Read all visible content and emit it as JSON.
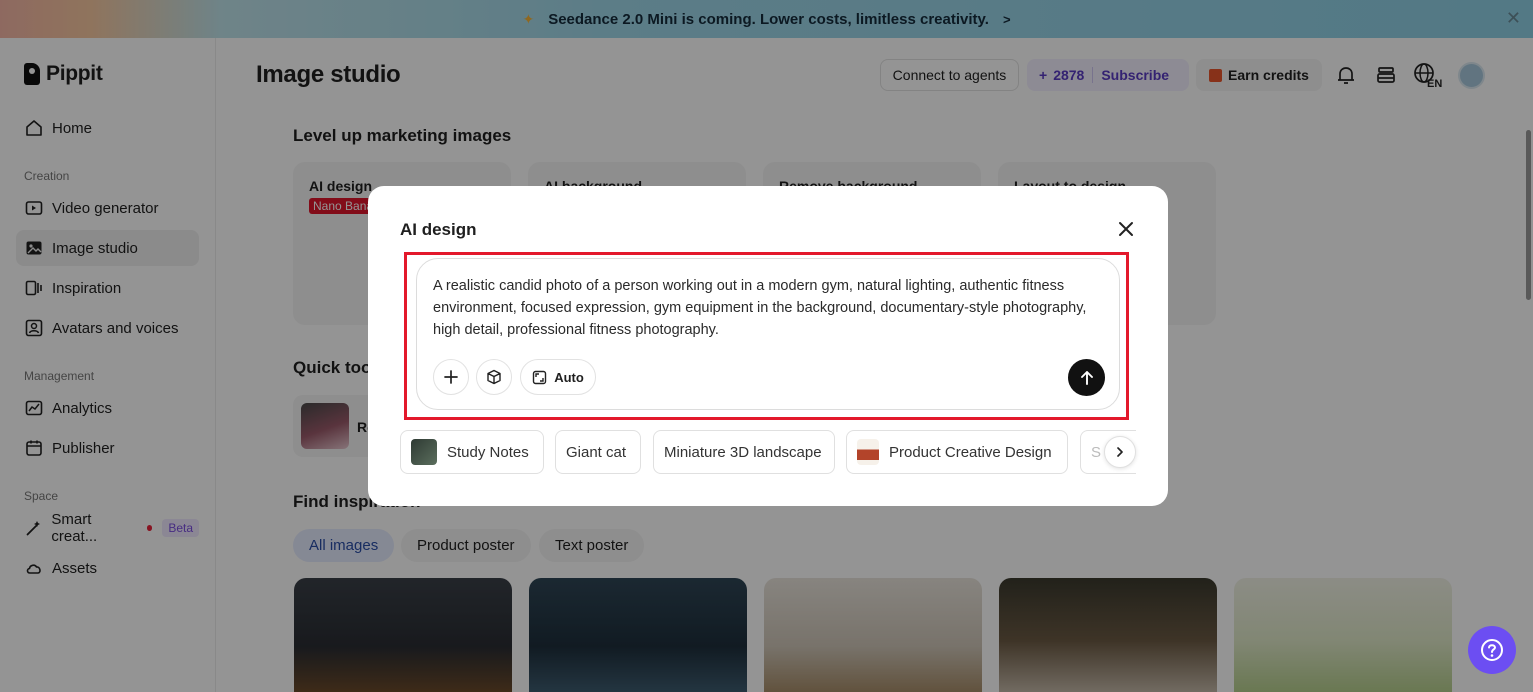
{
  "banner": {
    "text": "Seedance 2.0 Mini is coming. Lower costs, limitless creativity.",
    "arrow": ">"
  },
  "brand": {
    "name": "Pippit"
  },
  "sidebar": {
    "home": "Home",
    "sections": {
      "creation": "Creation",
      "management": "Management",
      "space": "Space"
    },
    "creation_items": [
      "Video generator",
      "Image studio",
      "Inspiration",
      "Avatars and voices"
    ],
    "management_items": [
      "Analytics",
      "Publisher"
    ],
    "space_items": {
      "smart": "Smart creat...",
      "beta": "Beta",
      "assets": "Assets"
    }
  },
  "header": {
    "title": "Image studio",
    "connect": "Connect to agents",
    "credits_plus": "+",
    "credits_count": "2878",
    "subscribe": "Subscribe",
    "earn": "Earn credits"
  },
  "content": {
    "level_up": "Level up marketing images",
    "cards": [
      "AI design",
      "AI background",
      "Remove background",
      "Layout to design"
    ],
    "card_tag": "Nano Banana",
    "quick_tools": "Quick tools",
    "quick_tool_label": "Re",
    "find_inspiration": "Find inspiration",
    "filters": [
      "All images",
      "Product poster",
      "Text poster"
    ]
  },
  "modal": {
    "title": "AI design",
    "prompt": "A realistic candid photo of a person working out in a modern gym, natural lighting, authentic fitness environment, focused expression, gym equipment in the background, documentary-style photography, high detail, professional fitness photography.",
    "auto_label": "Auto",
    "suggestions": [
      "Study Notes",
      "Giant cat",
      "Miniature 3D landscape",
      "Product Creative Design",
      "S"
    ]
  },
  "colors": {
    "accent": "#6c4ef2",
    "highlight": "#e3182b",
    "tag": "#e0162b"
  }
}
